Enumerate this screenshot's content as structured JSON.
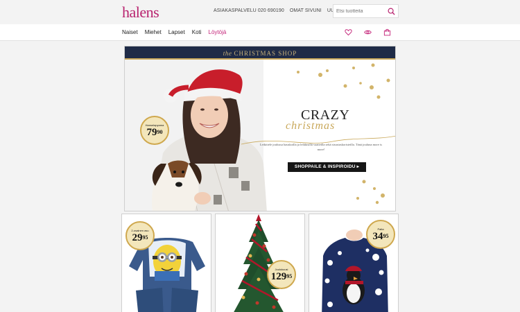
{
  "header": {
    "logo": "halens",
    "links": [
      {
        "label": "ASIAKASPALVELU 020 690190"
      },
      {
        "label": "OMAT SIVUNI"
      },
      {
        "label": "UUTISKIRJE"
      }
    ],
    "search_placeholder": "Etsi tuotteita"
  },
  "nav": {
    "items": [
      {
        "label": "Naiset"
      },
      {
        "label": "Miehet"
      },
      {
        "label": "Lapset"
      },
      {
        "label": "Koti"
      },
      {
        "label": "Löytöjä"
      }
    ],
    "icons": [
      "heart-icon",
      "eye-icon",
      "shopping-bag-icon"
    ]
  },
  "hero": {
    "strip_prefix": "the",
    "strip_title": "CHRISTMAS SHOP",
    "badge_label": "Hanselapyama",
    "badge_price": "79",
    "badge_cents": "90",
    "headline": "CRAZY",
    "headline_script": "christmas",
    "body_text": "Leikittele joulussa hauskoilla ja leikkisillä vaatteilla sekä sisustuskoristeilla. Tänä jouluna more is more!",
    "cta_label": "SHOPPAILE & INSPIROIDU ▸"
  },
  "products": [
    {
      "badge_label": "2-osainen asu",
      "price": "29",
      "cents": "95"
    },
    {
      "badge_label": "Joulukuusi",
      "price": "129",
      "cents": "95"
    },
    {
      "badge_label": "Paita",
      "price": "34",
      "cents": "95"
    }
  ],
  "colors": {
    "brand": "#b8236f",
    "nav_highlight": "#c4257a",
    "strip": "#1f2b47",
    "gold": "#c9a85a",
    "badge_fill": "#f3e6bb"
  }
}
